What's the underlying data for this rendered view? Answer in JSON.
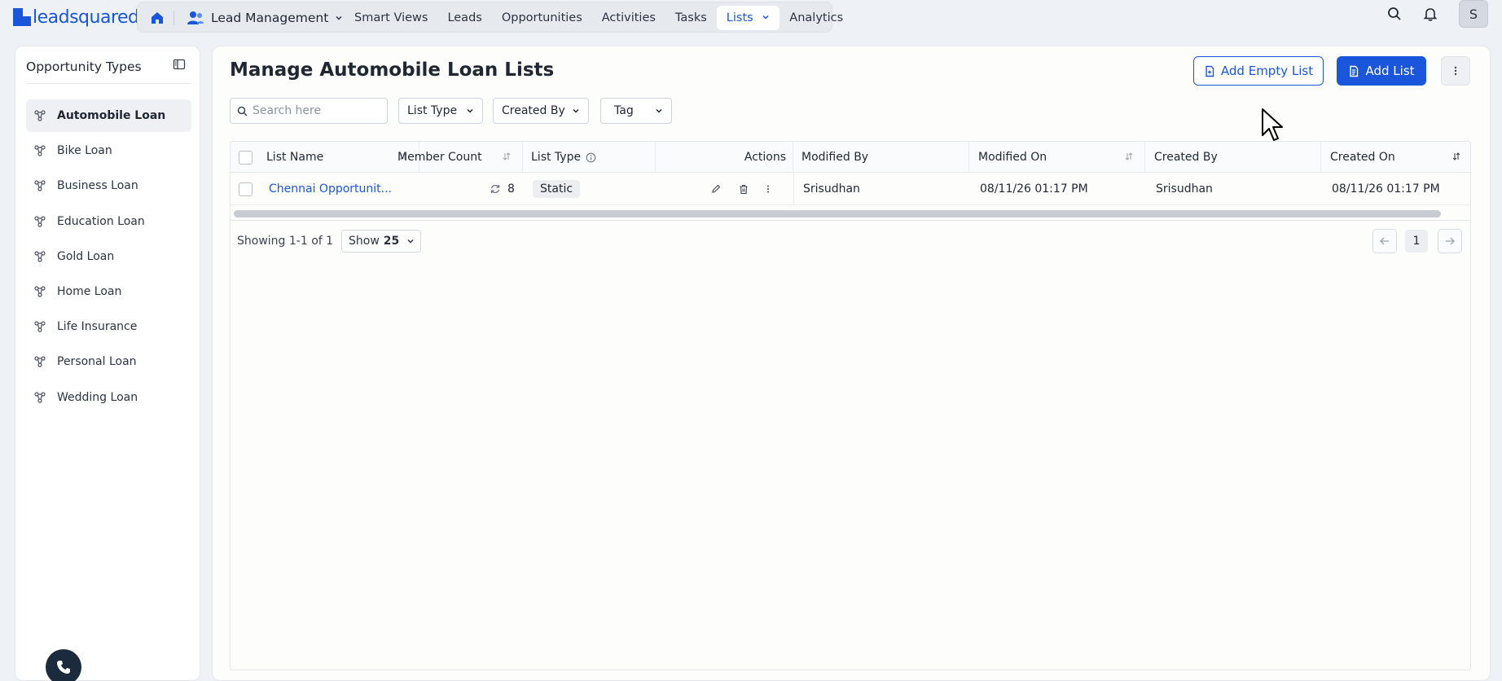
{
  "brand": {
    "logo_text": "leadsquared",
    "accent": "#1a56db"
  },
  "topnav": {
    "app_name": "Lead Management",
    "items": [
      {
        "label": "Smart Views",
        "active": false
      },
      {
        "label": "Leads",
        "active": false
      },
      {
        "label": "Opportunities",
        "active": false
      },
      {
        "label": "Activities",
        "active": false
      },
      {
        "label": "Tasks",
        "active": false
      },
      {
        "label": "Lists",
        "active": true
      },
      {
        "label": "Analytics",
        "active": false
      }
    ],
    "avatar_initial": "S"
  },
  "sidebar": {
    "title": "Opportunity Types",
    "items": [
      {
        "label": "Automobile Loan",
        "active": true
      },
      {
        "label": "Bike Loan",
        "active": false
      },
      {
        "label": "Business Loan",
        "active": false
      },
      {
        "label": "Education Loan",
        "active": false
      },
      {
        "label": "Gold Loan",
        "active": false
      },
      {
        "label": "Home Loan",
        "active": false
      },
      {
        "label": "Life Insurance",
        "active": false
      },
      {
        "label": "Personal Loan",
        "active": false
      },
      {
        "label": "Wedding Loan",
        "active": false
      }
    ]
  },
  "main": {
    "title": "Manage Automobile Loan Lists",
    "add_empty_list_label": "Add Empty List",
    "add_list_label": "Add List",
    "search_placeholder": "Search here",
    "filters": {
      "list_type": "List Type",
      "created_by": "Created By",
      "tag": "Tag"
    },
    "table": {
      "columns": {
        "list_name": "List Name",
        "member_count": "Member Count",
        "list_type": "List Type",
        "actions": "Actions",
        "modified_by": "Modified By",
        "modified_on": "Modified On",
        "created_by": "Created By",
        "created_on": "Created On"
      },
      "rows": [
        {
          "list_name": "Chennai Opportunit...",
          "member_count": "8",
          "list_type": "Static",
          "modified_by": "Srisudhan",
          "modified_on": "08/11/26 01:17 PM",
          "created_by": "Srisudhan",
          "created_on": "08/11/26 01:17 PM"
        }
      ]
    },
    "pagination": {
      "showing": "Showing 1-1 of 1",
      "show_label": "Show",
      "page_size": "25",
      "current_page": "1"
    }
  }
}
